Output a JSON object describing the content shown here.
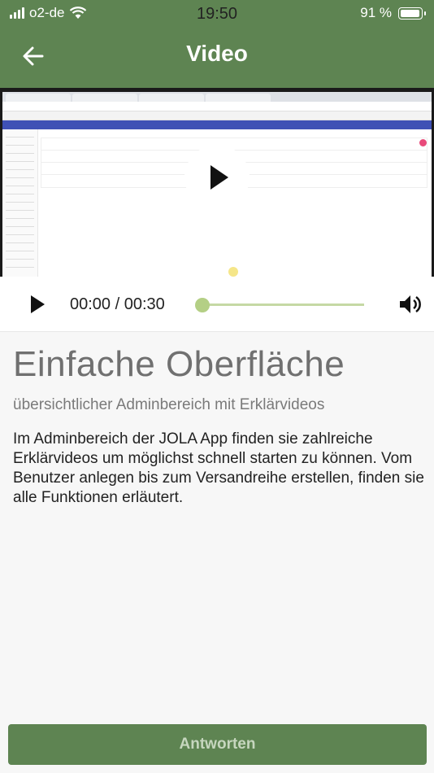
{
  "status_bar": {
    "carrier": "o2-de",
    "time": "19:50",
    "battery": "91 %"
  },
  "header": {
    "title": "Video"
  },
  "player": {
    "time_display": "00:00 / 00:30",
    "progress": 0
  },
  "content": {
    "heading": "Einfache Oberfläche",
    "subtitle": "übersichtlicher Adminbereich mit Erklärvideos",
    "body": "Im Adminbereich der JOLA App finden sie zahlreiche Erklärvideos um möglichst schnell starten zu können. Vom Benutzer anlegen bis zum Versandreihe erstellen, finden sie alle Funktionen erläutert."
  },
  "footer": {
    "answer_label": "Antworten"
  },
  "colors": {
    "brand_green": "#5e8452",
    "progress_green": "#b4cf85"
  },
  "icons": [
    "signal-icon",
    "wifi-icon",
    "battery-icon",
    "back-arrow-icon",
    "play-icon",
    "volume-icon"
  ]
}
